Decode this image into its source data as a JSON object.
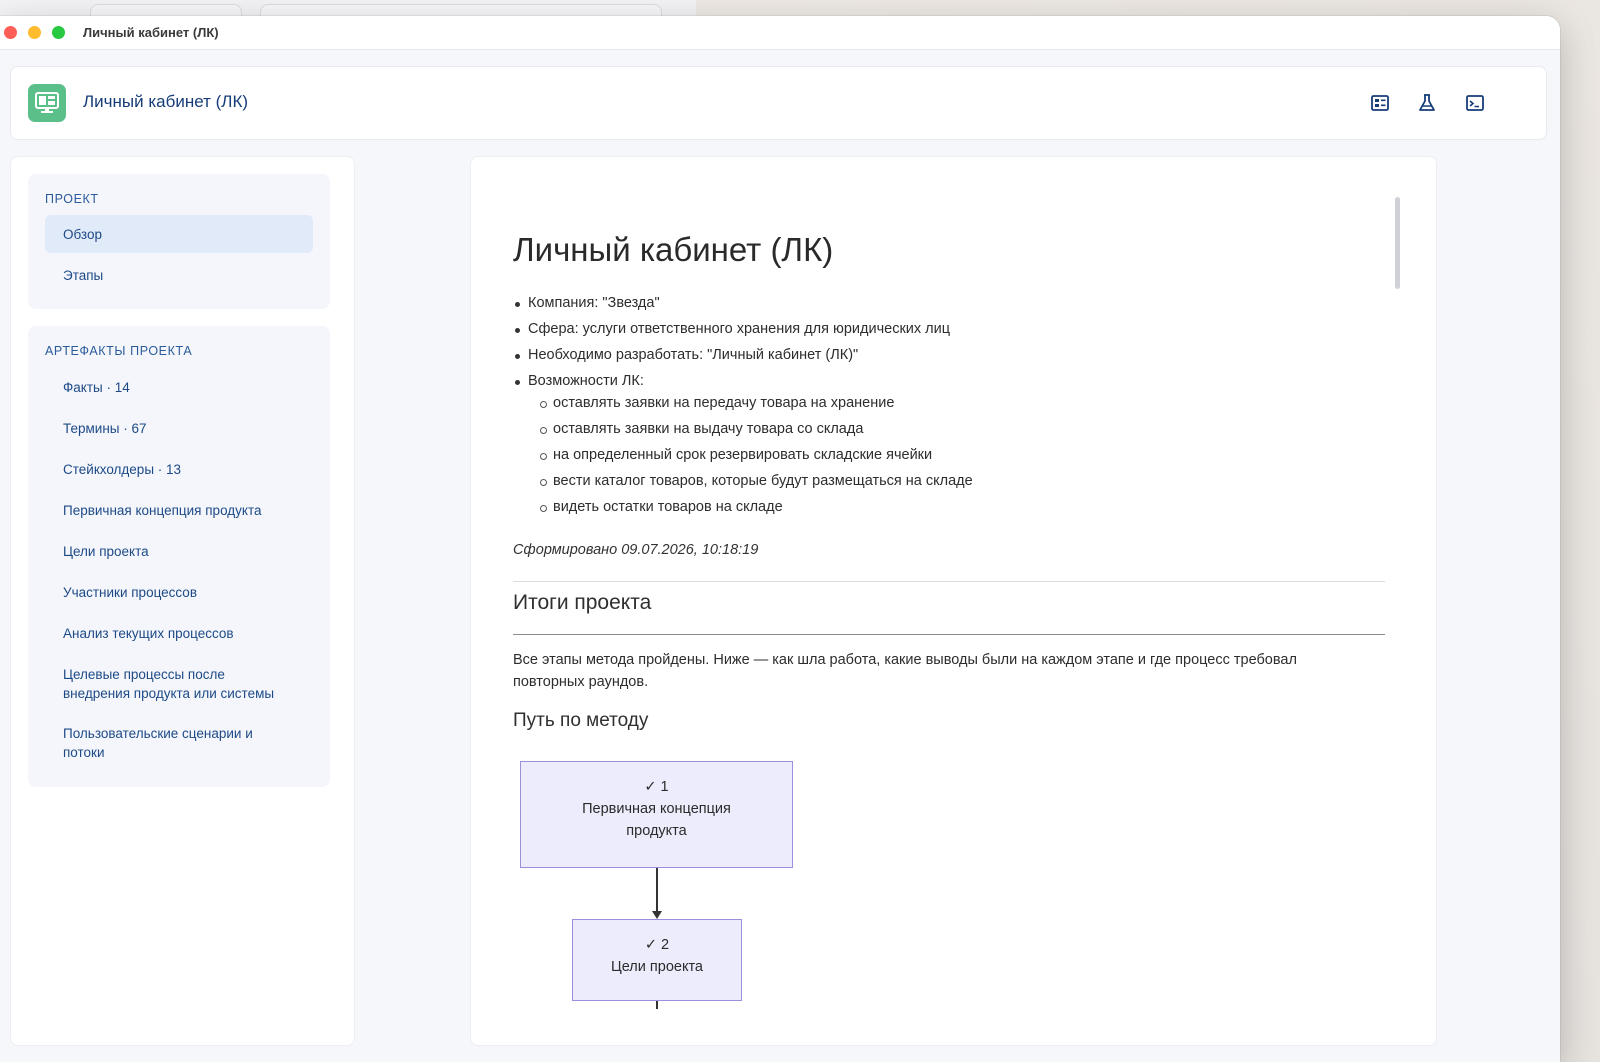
{
  "window": {
    "title": "Личный кабинет (ЛК)"
  },
  "header": {
    "title": "Личный кабинет (ЛК)",
    "icons": [
      "dashboard-icon",
      "flask-icon",
      "terminal-icon"
    ]
  },
  "sidebar": {
    "project_label": "ПРОЕКТ",
    "project_items": [
      {
        "label": "Обзор",
        "active": true
      },
      {
        "label": "Этапы",
        "active": false
      }
    ],
    "artifacts_label": "АРТЕФАКТЫ ПРОЕКТА",
    "artifact_items": [
      {
        "label": "Факты · 14"
      },
      {
        "label": "Термины · 67"
      },
      {
        "label": "Стейкхолдеры · 13"
      },
      {
        "label": "Первичная концепция продукта"
      },
      {
        "label": "Цели проекта"
      },
      {
        "label": "Участники процессов"
      },
      {
        "label": "Анализ текущих процессов"
      },
      {
        "label": "Целевые процессы после внедрения продукта или системы"
      },
      {
        "label": "Пользовательские сценарии и потоки"
      }
    ]
  },
  "document": {
    "title": "Личный кабинет (ЛК)",
    "bullets": [
      "Компания: \"Звезда\"",
      "Сфера: услуги ответственного хранения для юридических лиц",
      "Необходимо разработать: \"Личный кабинет (ЛК)\"",
      "Возможности ЛК:"
    ],
    "sub_bullets": [
      "оставлять заявки на передачу товара на хранение",
      "оставлять заявки на выдачу товара со склада",
      "на определенный срок резервировать складские ячейки",
      "вести каталог товаров, которые будут размещаться на складе",
      "видеть остатки товаров на складе"
    ],
    "generated": "Сформировано 09.07.2026, 10:18:19",
    "results_heading": "Итоги проекта",
    "results_text": "Все этапы метода пройдены. Ниже — как шла работа, какие выводы были на каждом этапе и где процесс требовал повторных раундов.",
    "path_heading": "Путь по методу",
    "flow": [
      {
        "step": "✓ 1",
        "line1": "Первичная концепция",
        "line2": "продукта"
      },
      {
        "step": "✓ 2",
        "line1": "Цели проекта",
        "line2": ""
      }
    ]
  },
  "colors": {
    "accent": "#163d78",
    "logo": "#5bbf8a",
    "active_item": "#e1eaf8",
    "flow_fill": "#ececfd",
    "flow_border": "#9b8fdc"
  }
}
